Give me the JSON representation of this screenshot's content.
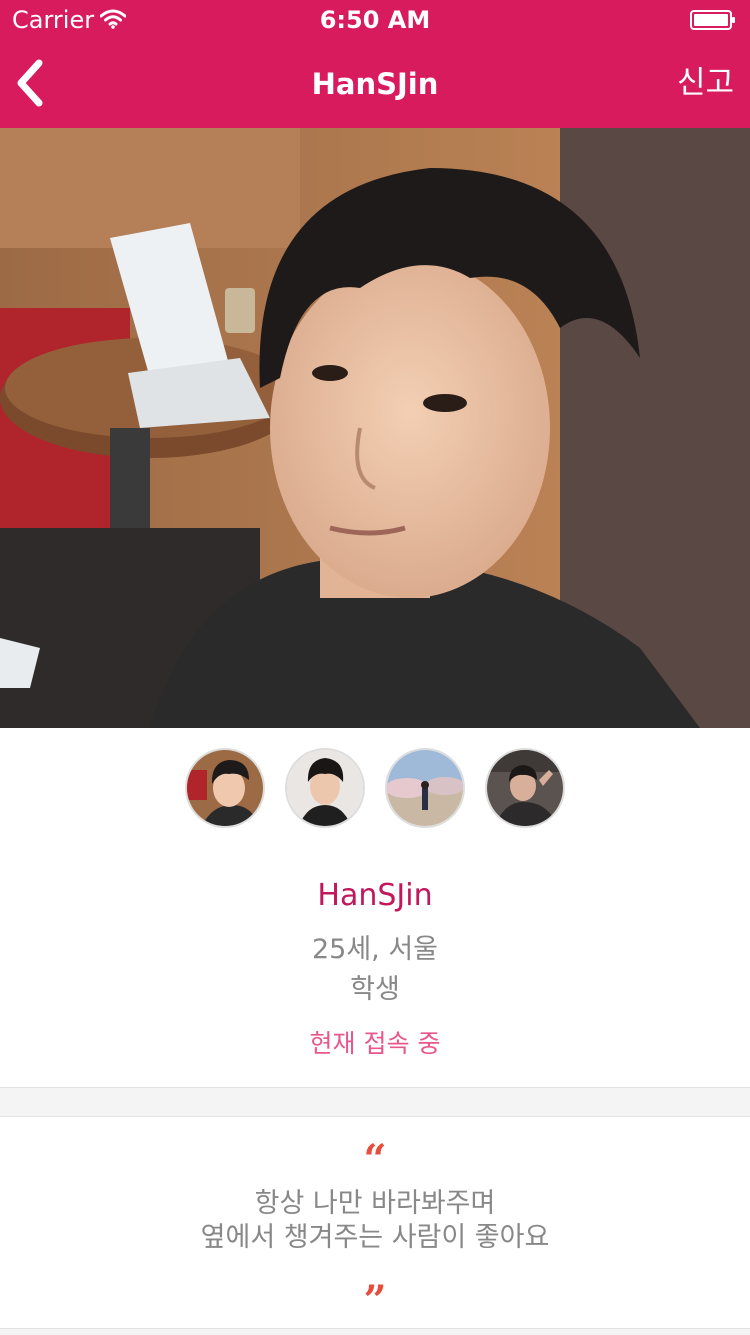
{
  "status_bar": {
    "carrier": "Carrier",
    "time": "6:50 AM"
  },
  "nav": {
    "title": "HanSJin",
    "report_label": "신고",
    "back_icon": "chevron-left-icon"
  },
  "profile": {
    "name": "HanSJin",
    "age_location": "25세, 서울",
    "occupation": "학생",
    "online_status": "현재 접속 중"
  },
  "quote": {
    "open_mark": "“",
    "line1": "항상 나만 바라봐주며",
    "line2": "옆에서 챙겨주는 사람이 좋아요",
    "close_mark": "”"
  },
  "colors": {
    "brand": "#d81b5c",
    "name_accent": "#c2185b",
    "online_accent": "#e8578a",
    "quote_mark": "#e74c3c",
    "meta_text": "#888888"
  }
}
